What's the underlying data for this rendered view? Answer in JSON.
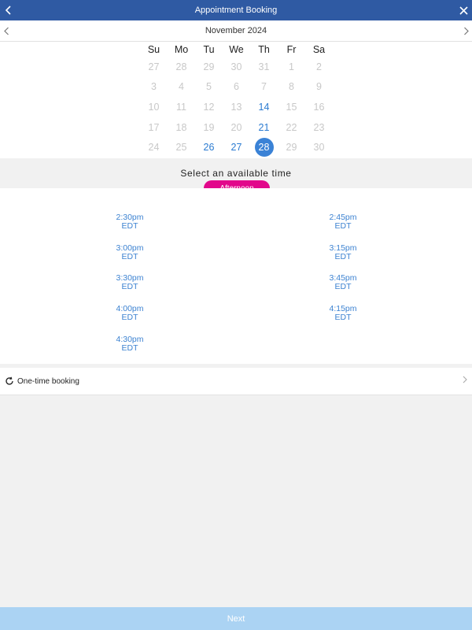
{
  "header": {
    "title": "Appointment Booking",
    "back_icon": "chevron-left-icon",
    "close_icon": "close-icon"
  },
  "calendar": {
    "month_label": "November 2024",
    "weekdays": [
      "Su",
      "Mo",
      "Tu",
      "We",
      "Th",
      "Fr",
      "Sa"
    ],
    "weeks": [
      [
        {
          "d": "27",
          "s": "off"
        },
        {
          "d": "28",
          "s": "off"
        },
        {
          "d": "29",
          "s": "off"
        },
        {
          "d": "30",
          "s": "off"
        },
        {
          "d": "31",
          "s": "off"
        },
        {
          "d": "1",
          "s": "off"
        },
        {
          "d": "2",
          "s": "off"
        }
      ],
      [
        {
          "d": "3",
          "s": "off"
        },
        {
          "d": "4",
          "s": "off"
        },
        {
          "d": "5",
          "s": "off"
        },
        {
          "d": "6",
          "s": "off"
        },
        {
          "d": "7",
          "s": "off"
        },
        {
          "d": "8",
          "s": "off"
        },
        {
          "d": "9",
          "s": "off"
        }
      ],
      [
        {
          "d": "10",
          "s": "off"
        },
        {
          "d": "11",
          "s": "off"
        },
        {
          "d": "12",
          "s": "off"
        },
        {
          "d": "13",
          "s": "off"
        },
        {
          "d": "14",
          "s": "avail"
        },
        {
          "d": "15",
          "s": "off"
        },
        {
          "d": "16",
          "s": "off"
        }
      ],
      [
        {
          "d": "17",
          "s": "off"
        },
        {
          "d": "18",
          "s": "off"
        },
        {
          "d": "19",
          "s": "off"
        },
        {
          "d": "20",
          "s": "off"
        },
        {
          "d": "21",
          "s": "avail"
        },
        {
          "d": "22",
          "s": "off"
        },
        {
          "d": "23",
          "s": "off"
        }
      ],
      [
        {
          "d": "24",
          "s": "off"
        },
        {
          "d": "25",
          "s": "off"
        },
        {
          "d": "26",
          "s": "avail"
        },
        {
          "d": "27",
          "s": "avail"
        },
        {
          "d": "28",
          "s": "selected"
        },
        {
          "d": "29",
          "s": "off"
        },
        {
          "d": "30",
          "s": "off"
        }
      ]
    ]
  },
  "time_section": {
    "heading": "Select an available time",
    "period_label": "Afternoon"
  },
  "slots": [
    {
      "time": "2:30pm",
      "tz": "EDT"
    },
    {
      "time": "2:45pm",
      "tz": "EDT"
    },
    {
      "time": "3:00pm",
      "tz": "EDT"
    },
    {
      "time": "3:15pm",
      "tz": "EDT"
    },
    {
      "time": "3:30pm",
      "tz": "EDT"
    },
    {
      "time": "3:45pm",
      "tz": "EDT"
    },
    {
      "time": "4:00pm",
      "tz": "EDT"
    },
    {
      "time": "4:15pm",
      "tz": "EDT"
    },
    {
      "time": "4:30pm",
      "tz": "EDT"
    }
  ],
  "booking": {
    "label": "One-time booking",
    "icon": "refresh-icon"
  },
  "footer": {
    "next_label": "Next"
  },
  "colors": {
    "header_bg": "#2f5aa3",
    "accent_blue": "#3a82d6",
    "pill_pink": "#e2078b",
    "next_bg": "#abd3f3"
  }
}
